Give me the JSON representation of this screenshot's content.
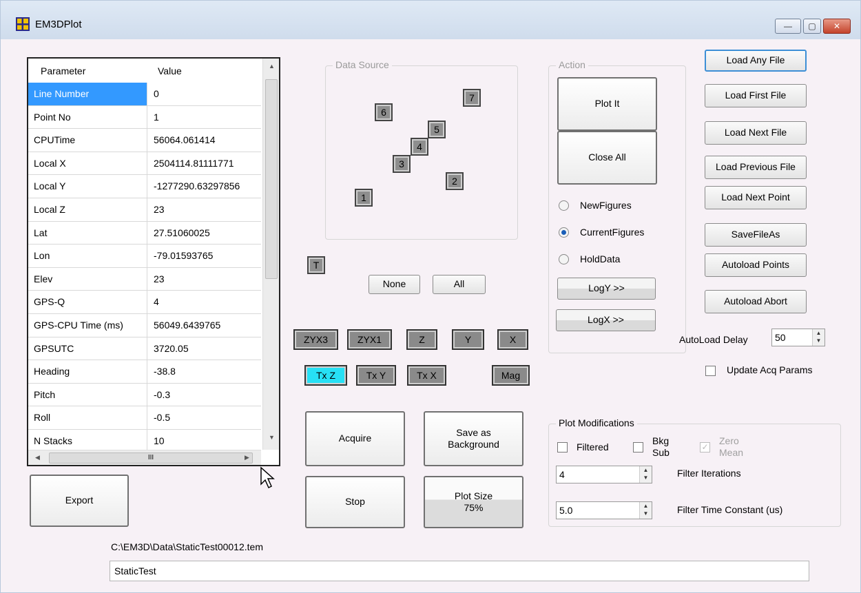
{
  "window": {
    "title": "EM3DPlot",
    "minimize": "—",
    "maximize": "▢",
    "close": "✕"
  },
  "grid": {
    "headers": [
      "Parameter",
      "Value"
    ],
    "rows": [
      {
        "p": "Line Number",
        "v": "0"
      },
      {
        "p": "Point No",
        "v": "1"
      },
      {
        "p": "CPUTime",
        "v": "56064.061414"
      },
      {
        "p": "Local X",
        "v": "2504114.81111771"
      },
      {
        "p": "Local Y",
        "v": "-1277290.63297856"
      },
      {
        "p": "Local Z",
        "v": "23"
      },
      {
        "p": "Lat",
        "v": "27.51060025"
      },
      {
        "p": "Lon",
        "v": "-79.01593765"
      },
      {
        "p": "Elev",
        "v": "23"
      },
      {
        "p": "GPS-Q",
        "v": "4"
      },
      {
        "p": "GPS-CPU Time (ms)",
        "v": "56049.6439765"
      },
      {
        "p": "GPSUTC",
        "v": "3720.05"
      },
      {
        "p": "Heading",
        "v": "-38.8"
      },
      {
        "p": "Pitch",
        "v": "-0.3"
      },
      {
        "p": "Roll",
        "v": "-0.5"
      },
      {
        "p": "N Stacks",
        "v": "10"
      }
    ],
    "hscroll_grip": "III"
  },
  "buttons": {
    "export": "Export",
    "acquire": "Acquire",
    "stop": "Stop",
    "save_bg_line1": "Save as",
    "save_bg_line2": "Background",
    "plot_size_line1": "Plot Size",
    "plot_size_line2": "75%",
    "plot_it": "Plot It",
    "close_all": "Close All",
    "logy": "LogY >>",
    "logx": "LogX >>",
    "none": "None",
    "all": "All",
    "t": "T"
  },
  "data_source": {
    "label": "Data Source",
    "channels": [
      "1",
      "2",
      "3",
      "4",
      "5",
      "6",
      "7"
    ]
  },
  "component_buttons": {
    "row1": [
      "ZYX3",
      "ZYX1",
      "Z",
      "Y",
      "X"
    ],
    "row2": [
      "Tx Z",
      "Tx Y",
      "Tx X",
      "Mag"
    ]
  },
  "action": {
    "label": "Action",
    "radios": [
      "NewFigures",
      "CurrentFigures",
      "HoldData"
    ],
    "selected": "CurrentFigures"
  },
  "file_buttons": [
    "Load Any File",
    "Load First File",
    "Load Next File",
    "Load Previous File",
    "Load Next Point",
    "SaveFileAs",
    "Autoload Points",
    "Autoload Abort"
  ],
  "autoload": {
    "label": "AutoLoad Delay",
    "value": "50",
    "update_label": "Update Acq Params"
  },
  "plot_mods": {
    "label": "Plot Modifications",
    "filtered": "Filtered",
    "bkg_line1": "Bkg",
    "bkg_line2": "Sub",
    "zero_line1": "Zero",
    "zero_line2": "Mean",
    "iterations_value": "4",
    "iterations_label": "Filter Iterations",
    "time_value": "5.0",
    "time_label": "Filter Time Constant (us)"
  },
  "footer": {
    "path": "C:\\EM3D\\Data\\StaticTest00012.tem",
    "name_value": "StaticTest"
  }
}
